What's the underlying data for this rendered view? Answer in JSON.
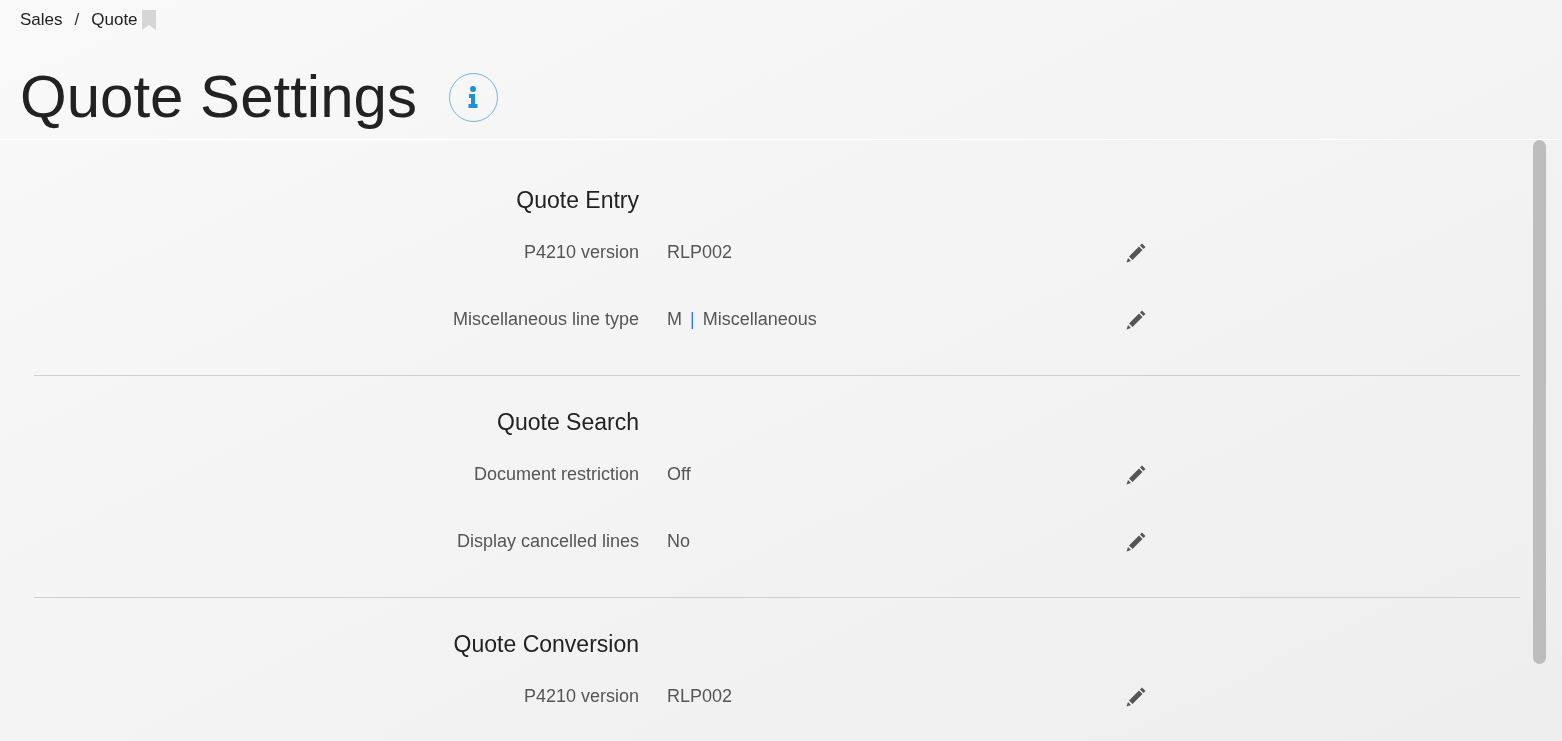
{
  "breadcrumb": [
    {
      "label": "Sales"
    },
    {
      "label": "Quote"
    }
  ],
  "breadcrumb_separator": "/",
  "title": "Quote Settings",
  "sections": [
    {
      "heading": "Quote Entry",
      "settings": [
        {
          "kind": "plain",
          "label": "P4210 version",
          "value": "RLP002"
        },
        {
          "kind": "coded",
          "label": "Miscellaneous line type",
          "code": "M",
          "separator": "|",
          "description": "Miscellaneous"
        }
      ]
    },
    {
      "heading": "Quote Search",
      "settings": [
        {
          "kind": "plain",
          "label": "Document restriction",
          "value": "Off"
        },
        {
          "kind": "plain",
          "label": "Display cancelled lines",
          "value": "No"
        }
      ]
    },
    {
      "heading": "Quote Conversion",
      "settings": [
        {
          "kind": "plain",
          "label": "P4210 version",
          "value": "RLP002"
        }
      ]
    }
  ]
}
